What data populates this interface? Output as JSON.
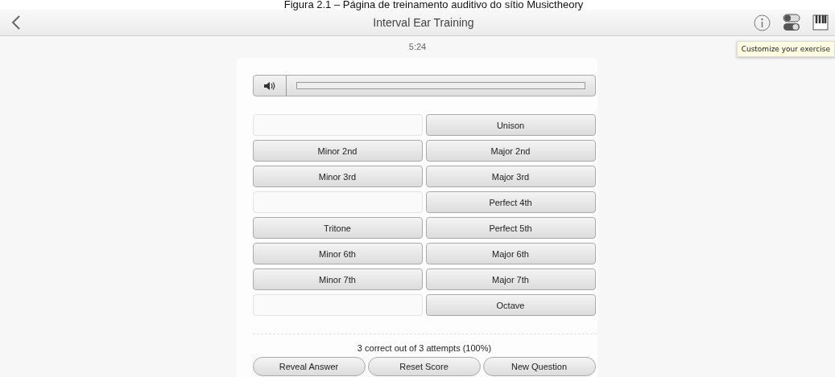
{
  "caption": "Figura 2.1 – Página de treinamento auditivo do sítio Musictheory",
  "header": {
    "title": "Interval Ear Training"
  },
  "tooltip": "Customize your exercise",
  "timer": "5:24",
  "answers": [
    {
      "kind": "blank"
    },
    {
      "kind": "choice",
      "label": "Unison"
    },
    {
      "kind": "choice",
      "label": "Minor 2nd"
    },
    {
      "kind": "choice",
      "label": "Major 2nd"
    },
    {
      "kind": "choice",
      "label": "Minor 3rd"
    },
    {
      "kind": "choice",
      "label": "Major 3rd"
    },
    {
      "kind": "blank"
    },
    {
      "kind": "choice",
      "label": "Perfect 4th"
    },
    {
      "kind": "choice",
      "label": "Tritone"
    },
    {
      "kind": "choice",
      "label": "Perfect 5th"
    },
    {
      "kind": "choice",
      "label": "Minor 6th"
    },
    {
      "kind": "choice",
      "label": "Major 6th"
    },
    {
      "kind": "choice",
      "label": "Minor 7th"
    },
    {
      "kind": "choice",
      "label": "Major 7th"
    },
    {
      "kind": "blank"
    },
    {
      "kind": "choice",
      "label": "Octave"
    }
  ],
  "score": "3 correct out of 3 attempts (100%)",
  "buttons": [
    "Reveal Answer",
    "Reset Score",
    "New Question"
  ]
}
